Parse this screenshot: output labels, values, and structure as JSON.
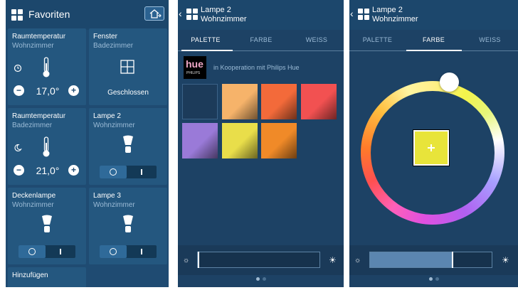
{
  "screen1": {
    "title": "Favoriten",
    "tiles": [
      {
        "name": "Raumtemperatur",
        "room": "Wohnzimmer",
        "value": "17,0°"
      },
      {
        "name": "Fenster",
        "room": "Badezimmer",
        "status": "Geschlossen"
      },
      {
        "name": "Raumtemperatur",
        "room": "Badezimmer",
        "value": "21,0°"
      },
      {
        "name": "Lampe 2",
        "room": "Wohnzimmer"
      },
      {
        "name": "Deckenlampe",
        "room": "Wohnzimmer"
      },
      {
        "name": "Lampe 3",
        "room": "Wohnzimmer"
      }
    ],
    "add_label": "Hinzufügen",
    "minus": "−",
    "plus": "+"
  },
  "screen2": {
    "title": "Lampe 2",
    "subtitle": "Wohnzimmer",
    "tabs": [
      "PALETTE",
      "FARBE",
      "WEISS"
    ],
    "active_tab": "PALETTE",
    "hue_logo": "hue",
    "hue_logo_sub": "PHILIPS",
    "coop_text": "in Kooperation mit Philips Hue",
    "swatches": [
      "#1c3b5a",
      "#f6b36a",
      "#f36a3a",
      "#f25151",
      "#9a7ad8",
      "#e9de4a",
      "#f08a28"
    ],
    "brightness": 0.0
  },
  "screen3": {
    "title": "Lampe 2",
    "subtitle": "Wohnzimmer",
    "tabs": [
      "PALETTE",
      "FARBE",
      "WEISS"
    ],
    "active_tab": "FARBE",
    "selected_color": "#e8e43a",
    "brightness": 0.67
  }
}
